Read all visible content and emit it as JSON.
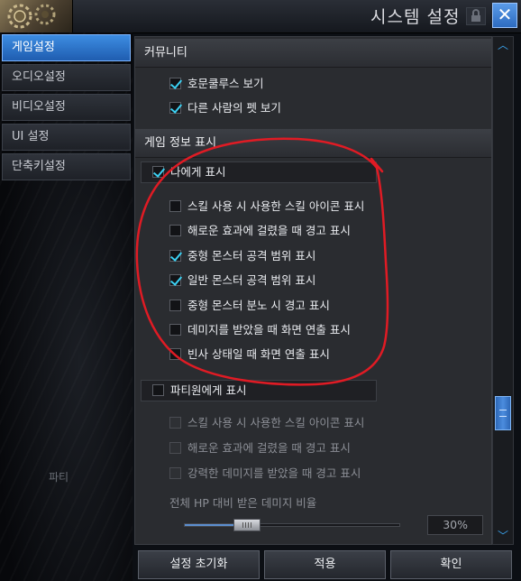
{
  "window": {
    "title": "시스템 설정"
  },
  "sidebar": {
    "items": [
      {
        "label": "게임설정",
        "active": true
      },
      {
        "label": "오디오설정",
        "active": false
      },
      {
        "label": "비디오설정",
        "active": false
      },
      {
        "label": "UI 설정",
        "active": false
      },
      {
        "label": "단축키설정",
        "active": false
      }
    ],
    "faded_text": "파티"
  },
  "community": {
    "header": "커뮤니티",
    "options": [
      {
        "label": "호문쿨루스 보기",
        "checked": true
      },
      {
        "label": "다른 사람의 펫 보기",
        "checked": true
      }
    ]
  },
  "game_info": {
    "header": "게임 정보 표시",
    "self_group": {
      "label": "나에게 표시",
      "checked": true,
      "options": [
        {
          "label": "스킬 사용 시 사용한 스킬 아이콘 표시",
          "checked": false
        },
        {
          "label": "해로운 효과에 걸렸을 때 경고 표시",
          "checked": false
        },
        {
          "label": "중형 몬스터 공격 범위 표시",
          "checked": true
        },
        {
          "label": "일반 몬스터 공격 범위 표시",
          "checked": true
        },
        {
          "label": "중형 몬스터 분노 시 경고 표시",
          "checked": false
        },
        {
          "label": "데미지를 받았을 때 화면 연출 표시",
          "checked": false
        },
        {
          "label": "빈사 상태일 때 화면 연출 표시",
          "checked": false
        }
      ]
    },
    "party_group": {
      "label": "파티원에게 표시",
      "checked": false,
      "options": [
        {
          "label": "스킬 사용 시 사용한 스킬 아이콘 표시",
          "checked": false
        },
        {
          "label": "해로운 효과에 걸렸을 때 경고 표시",
          "checked": false
        },
        {
          "label": "강력한 데미지를 받았을 때 경고 표시",
          "checked": false
        }
      ],
      "hp_label": "전체 HP 대비 받은 데미지 비율",
      "hp_value": "30%"
    }
  },
  "buttons": {
    "reset": "설정 초기화",
    "apply": "적용",
    "confirm": "확인"
  },
  "colors": {
    "accent": "#3d8de2",
    "check": "#3bd0f2",
    "annotation": "#e01b24"
  }
}
